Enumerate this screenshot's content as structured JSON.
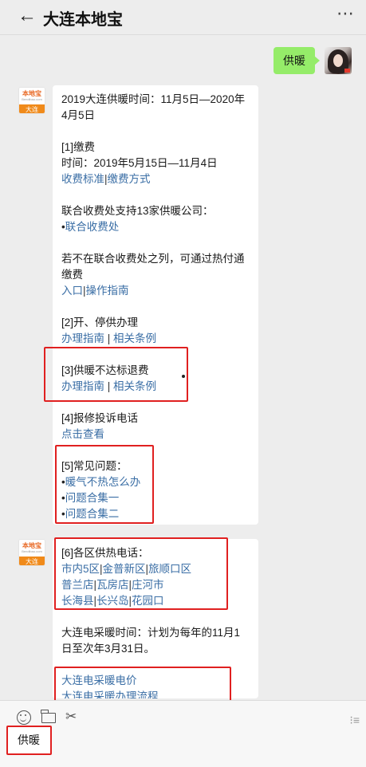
{
  "header": {
    "back_icon": "←",
    "title": "大连本地宝",
    "more_icon": "⋯"
  },
  "my_message": {
    "text": "供暖"
  },
  "bot": {
    "avatar_brand": "本地宝",
    "avatar_url_text": "Bendibao.com",
    "avatar_city": "大连"
  },
  "card1": {
    "intro": "2019大连供暖时间：11月5日—2020年4月5日",
    "s1_title": "[1]缴费",
    "s1_time": "时间：2019年5月15日—11月4日",
    "s1_link_a": "收费标准",
    "s1_link_b": "缴费方式",
    "union_text": "联合收费处支持13家供暖公司：",
    "union_bullet": "•",
    "union_link": "联合收费处",
    "reef_text": "若不在联合收费处之列，可通过热付通缴费",
    "reef_link_a": "入口",
    "reef_link_b": "操作指南",
    "s2_title": "[2]开、停供办理",
    "s2_link_a": "办理指南",
    "s2_link_b": "相关条例",
    "s3_title": "[3]供暖不达标退费",
    "s3_link_a": "办理指南",
    "s3_link_b": "相关条例",
    "s4_title": "[4]报修投诉电话",
    "s4_link": "点击查看",
    "s5_title": "[5]常见问题：",
    "s5_items": [
      "暖气不热怎么办",
      "问题合集一",
      "问题合集二"
    ],
    "sep": "|",
    "spaced_sep": " | "
  },
  "card2": {
    "s6_title": "[6]各区供热电话：",
    "row1": [
      "市内5区",
      "金普新区",
      "旅顺口区"
    ],
    "row2": [
      "普兰店",
      "瓦房店",
      "庄河市"
    ],
    "row3": [
      "长海县",
      "长兴岛",
      "花园口"
    ],
    "elec_text": "大连电采暖时间：计划为每年的11月1日至次年3月31日。",
    "elec_link_a": "大连电采暖电价",
    "elec_link_b": "大连电采暖办理流程"
  },
  "bottom": {
    "input_value": "供暖",
    "scissors_icon": "✂",
    "menu_icon": "⁝≡"
  }
}
